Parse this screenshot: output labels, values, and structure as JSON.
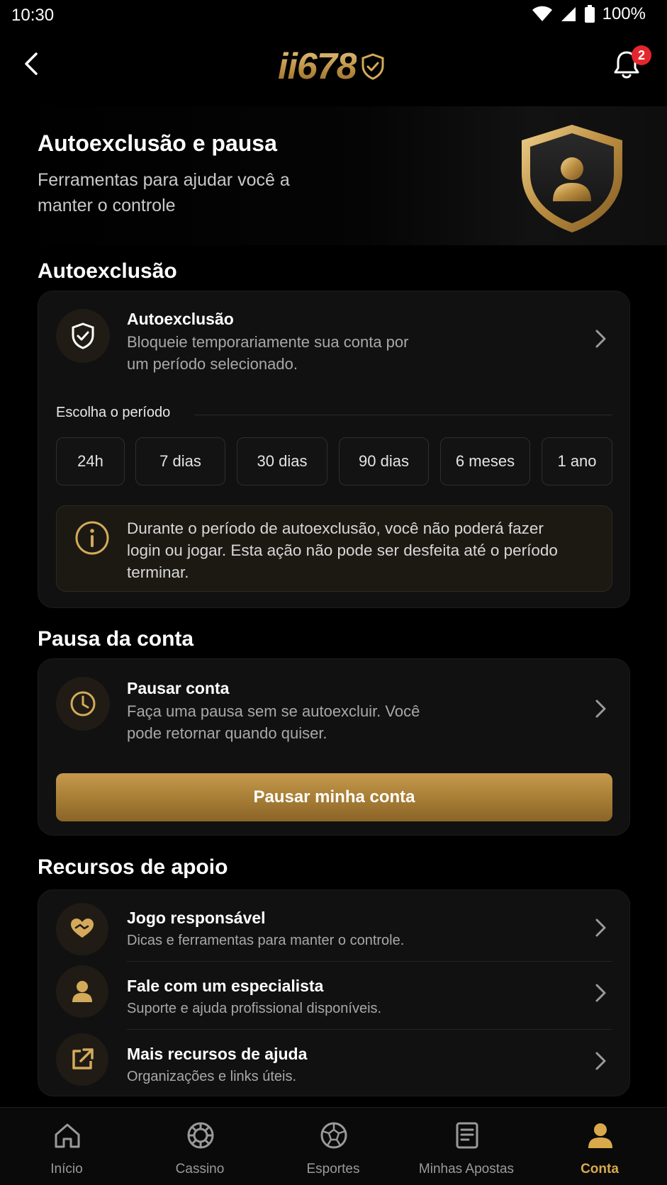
{
  "status_bar": {
    "time": "10:30",
    "battery": "100%"
  },
  "header": {
    "logo": "ii678",
    "notification_count": "2"
  },
  "hero": {
    "title": "Autoexclusão e pausa",
    "subtitle": "Ferramentas para ajudar você a manter o controle"
  },
  "self_exclusion": {
    "section_title": "Autoexclusão",
    "row_title": "Autoexclusão",
    "row_subtitle": "Bloqueie temporariamente sua conta por um período selecionado.",
    "period_label": "Escolha o período",
    "periods": [
      "24h",
      "7 dias",
      "30 dias",
      "90 dias",
      "6 meses",
      "1 ano"
    ],
    "warning": "Durante o período de autoexclusão, você não poderá fazer login ou jogar. Esta ação não pode ser desfeita até o período terminar."
  },
  "pause": {
    "section_title": "Pausa da conta",
    "row_title": "Pausar conta",
    "row_subtitle": "Faça uma pausa sem se autoexcluir. Você pode retornar quando quiser.",
    "button_label": "Pausar minha conta"
  },
  "support": {
    "section_title": "Recursos de apoio",
    "items": [
      {
        "title": "Jogo responsável",
        "subtitle": "Dicas e ferramentas para manter o controle.",
        "icon": "handshake-heart-icon"
      },
      {
        "title": "Fale com um especialista",
        "subtitle": "Suporte e ajuda profissional disponíveis.",
        "icon": "person-icon"
      },
      {
        "title": "Mais recursos de ajuda",
        "subtitle": "Organizações e links úteis.",
        "icon": "external-link-icon"
      }
    ]
  },
  "bottom_nav": {
    "items": [
      {
        "label": "Início",
        "icon": "home-icon"
      },
      {
        "label": "Cassino",
        "icon": "chip-icon"
      },
      {
        "label": "Esportes",
        "icon": "soccer-ball-icon"
      },
      {
        "label": "Minhas Apostas",
        "icon": "document-icon"
      },
      {
        "label": "Conta",
        "icon": "user-icon"
      }
    ],
    "active": "Conta"
  },
  "colors": {
    "accent_gold": "#c59a4e",
    "background": "#000000",
    "card": "#111111",
    "badge_red": "#e5272d"
  }
}
